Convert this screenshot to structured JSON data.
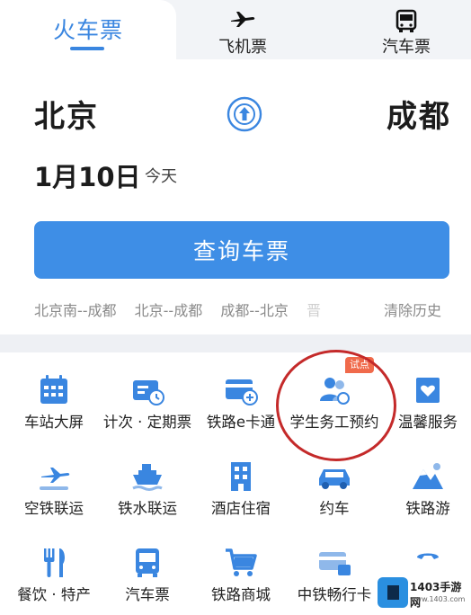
{
  "tabs": [
    {
      "label": "火车票",
      "icon": "train-ticket",
      "active": true
    },
    {
      "label": "飞机票",
      "icon": "plane-icon"
    },
    {
      "label": "汽车票",
      "icon": "bus-icon"
    }
  ],
  "route": {
    "from": "北京",
    "to": "成都",
    "swap_icon": "swap-icon"
  },
  "date": {
    "value": "1月10日",
    "sub": "今天"
  },
  "search_button": "查询车票",
  "history": {
    "items": [
      "北京南--成都",
      "北京--成都",
      "成都--北京",
      "晋"
    ],
    "clear": "清除历史"
  },
  "services": {
    "rows": [
      [
        {
          "label": "车站大屏",
          "icon": "station-screen-icon"
        },
        {
          "label": "计次 · 定期票",
          "icon": "periodic-ticket-icon"
        },
        {
          "label": "铁路e卡通",
          "icon": "railway-ecard-icon"
        },
        {
          "label": "学生务工预约",
          "icon": "student-worker-icon"
        },
        {
          "label": "温馨服务",
          "icon": "care-service-icon"
        }
      ],
      [
        {
          "label": "空铁联运",
          "icon": "air-rail-icon"
        },
        {
          "label": "铁水联运",
          "icon": "rail-water-icon"
        },
        {
          "label": "酒店住宿",
          "icon": "hotel-icon"
        },
        {
          "label": "约车",
          "icon": "car-icon"
        },
        {
          "label": "铁路游",
          "icon": "railway-tour-icon"
        }
      ],
      [
        {
          "label": "餐饮 · 特产",
          "icon": "food-icon"
        },
        {
          "label": "汽车票",
          "icon": "bus-icon"
        },
        {
          "label": "铁路商城",
          "icon": "cart-icon"
        },
        {
          "label": "中铁畅行卡",
          "icon": "card-icon"
        },
        {
          "label": "",
          "icon": "phone-icon"
        }
      ]
    ],
    "new_badge": "试点"
  },
  "watermark": {
    "text": "1403手游网",
    "url": "www.1403.com"
  },
  "colors": {
    "accent": "#3e8ee6",
    "icon": "#3a86e0",
    "badge": "#f06a4b",
    "circle": "#c42a2a"
  }
}
